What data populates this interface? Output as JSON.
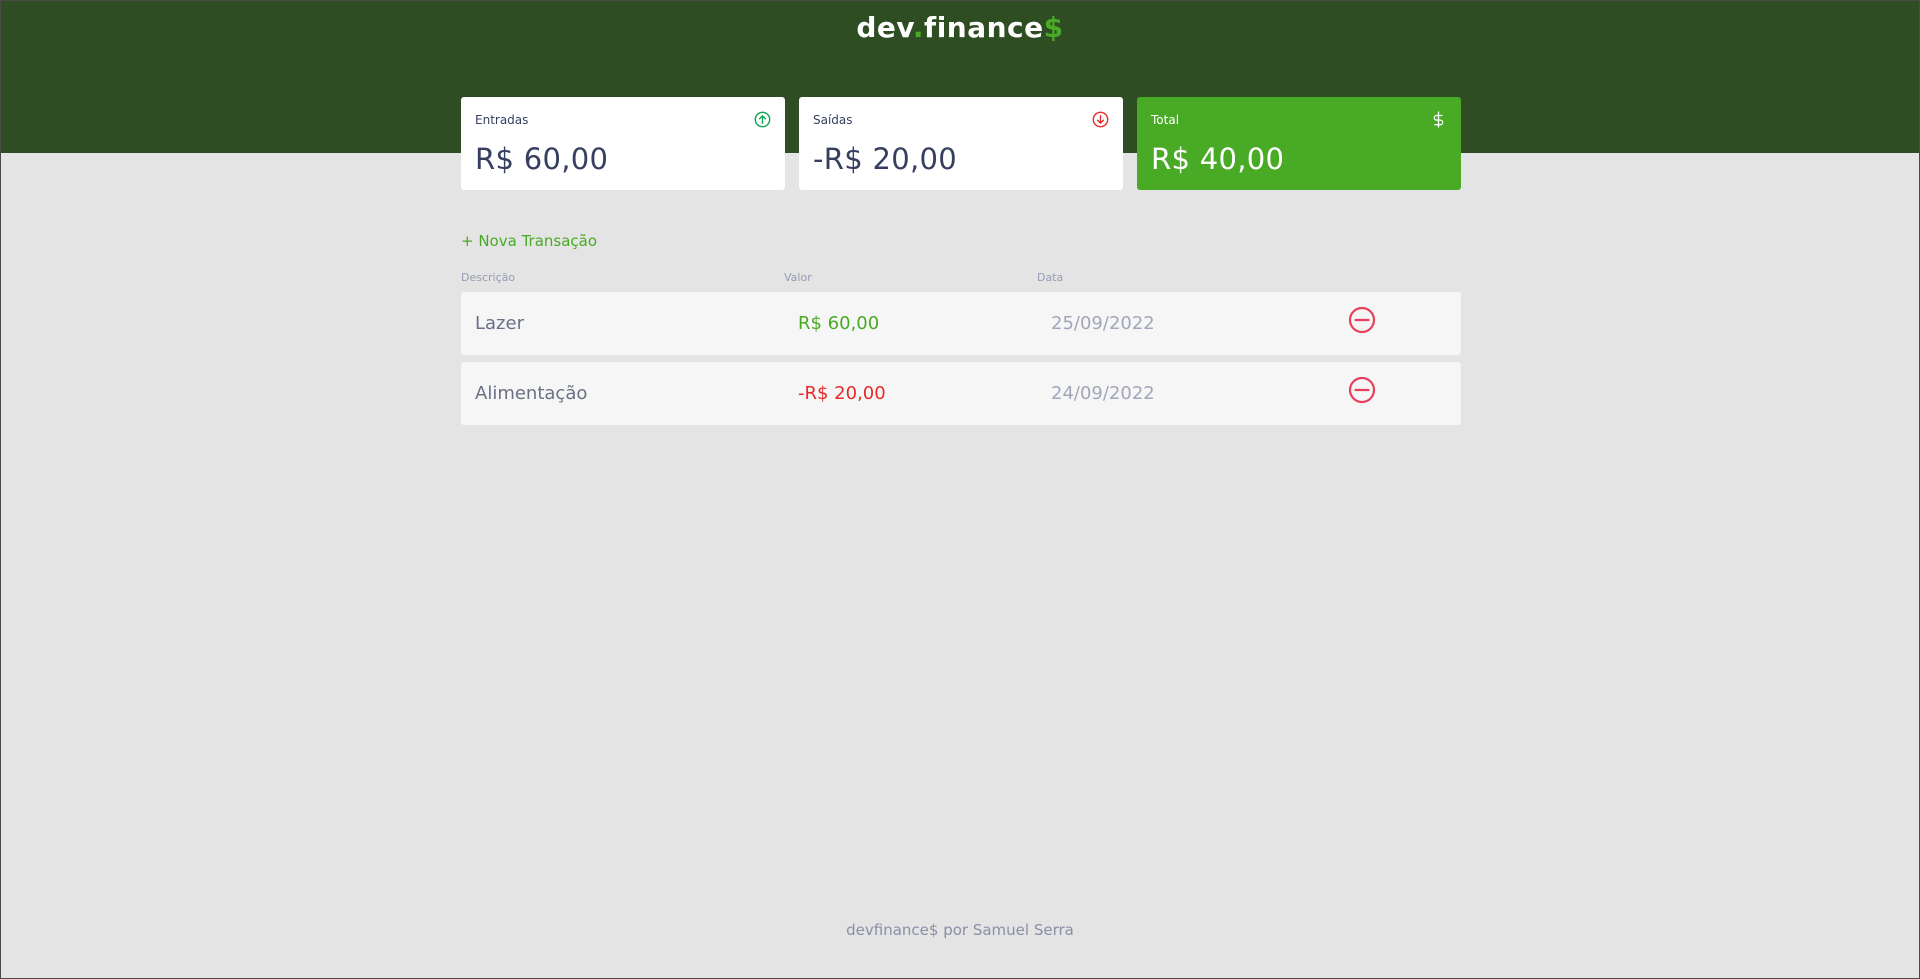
{
  "header": {
    "logo_dev": "dev",
    "logo_dot": ".",
    "logo_finance": "finance",
    "logo_dollar": "$"
  },
  "cards": [
    {
      "label": "Entradas",
      "value": "R$ 60,00",
      "icon": "arrow-up-circle-icon"
    },
    {
      "label": "Saídas",
      "value": "-R$ 20,00",
      "icon": "arrow-down-circle-icon"
    },
    {
      "label": "Total",
      "value": "R$ 40,00",
      "icon": "dollar-icon"
    }
  ],
  "new_transaction_label": "+ Nova Transação",
  "table": {
    "headers": {
      "description": "Descrição",
      "value": "Valor",
      "date": "Data"
    },
    "rows": [
      {
        "description": "Lazer",
        "value": "R$ 60,00",
        "date": "25/09/2022",
        "type": "income"
      },
      {
        "description": "Alimentação",
        "value": "-R$ 20,00",
        "date": "24/09/2022",
        "type": "expense"
      }
    ]
  },
  "footer": "devfinance$ por Samuel Serra",
  "colors": {
    "header_bg": "#2e4d23",
    "accent_green": "#49aa26",
    "expense_red": "#e92929",
    "page_bg": "#e4e4e4",
    "text_dark": "#363f5f"
  }
}
